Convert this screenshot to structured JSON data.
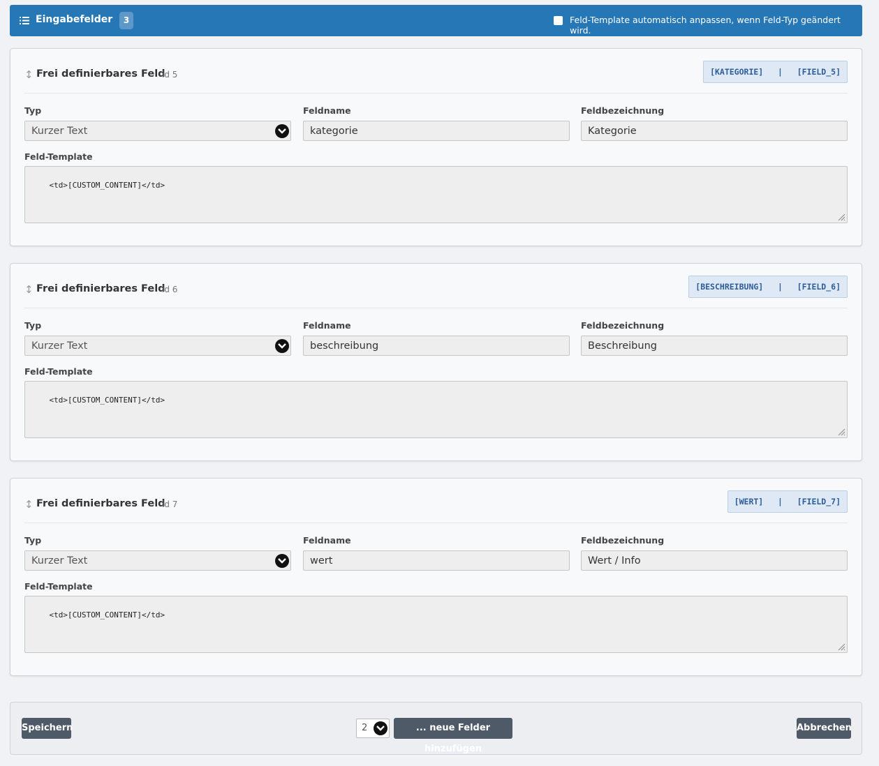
{
  "header": {
    "title": "Eingabefelder",
    "count": "3",
    "auto_adjust_label": "Feld-Template automatisch anpassen, wenn Feld-Typ geändert wird."
  },
  "labels": {
    "typ": "Typ",
    "feldname": "Feldname",
    "feldbezeichnung": "Feldbezeichnung",
    "template": "Feld-Template"
  },
  "fields": [
    {
      "title": "Frei definierbares Feld",
      "id": "id 5",
      "placeholders": "[KATEGORIE]   |   [FIELD_5]",
      "type": "Kurzer Text",
      "name": "kategorie",
      "label": "Kategorie",
      "template": "<td>[CUSTOM_CONTENT]</td>"
    },
    {
      "title": "Frei definierbares Feld",
      "id": "id 6",
      "placeholders": "[BESCHREIBUNG]   |   [FIELD_6]",
      "type": "Kurzer Text",
      "name": "beschreibung",
      "label": "Beschreibung",
      "template": "<td>[CUSTOM_CONTENT]</td>"
    },
    {
      "title": "Frei definierbares Feld",
      "id": "id 7",
      "placeholders": "[WERT]   |   [FIELD_7]",
      "type": "Kurzer Text",
      "name": "wert",
      "label": "Wert / Info",
      "template": "<td>[CUSTOM_CONTENT]</td>"
    }
  ],
  "footer": {
    "save_label": "Speichern",
    "new_count": "2",
    "add_label": "... neue Felder hinzufügen",
    "cancel_label": "Abbrechen"
  },
  "colors": {
    "header_bg": "#2577b6",
    "button_bg": "#4f5a68",
    "placeholder_bg": "#dfe9f5",
    "placeholder_text": "#2c5d9b"
  }
}
